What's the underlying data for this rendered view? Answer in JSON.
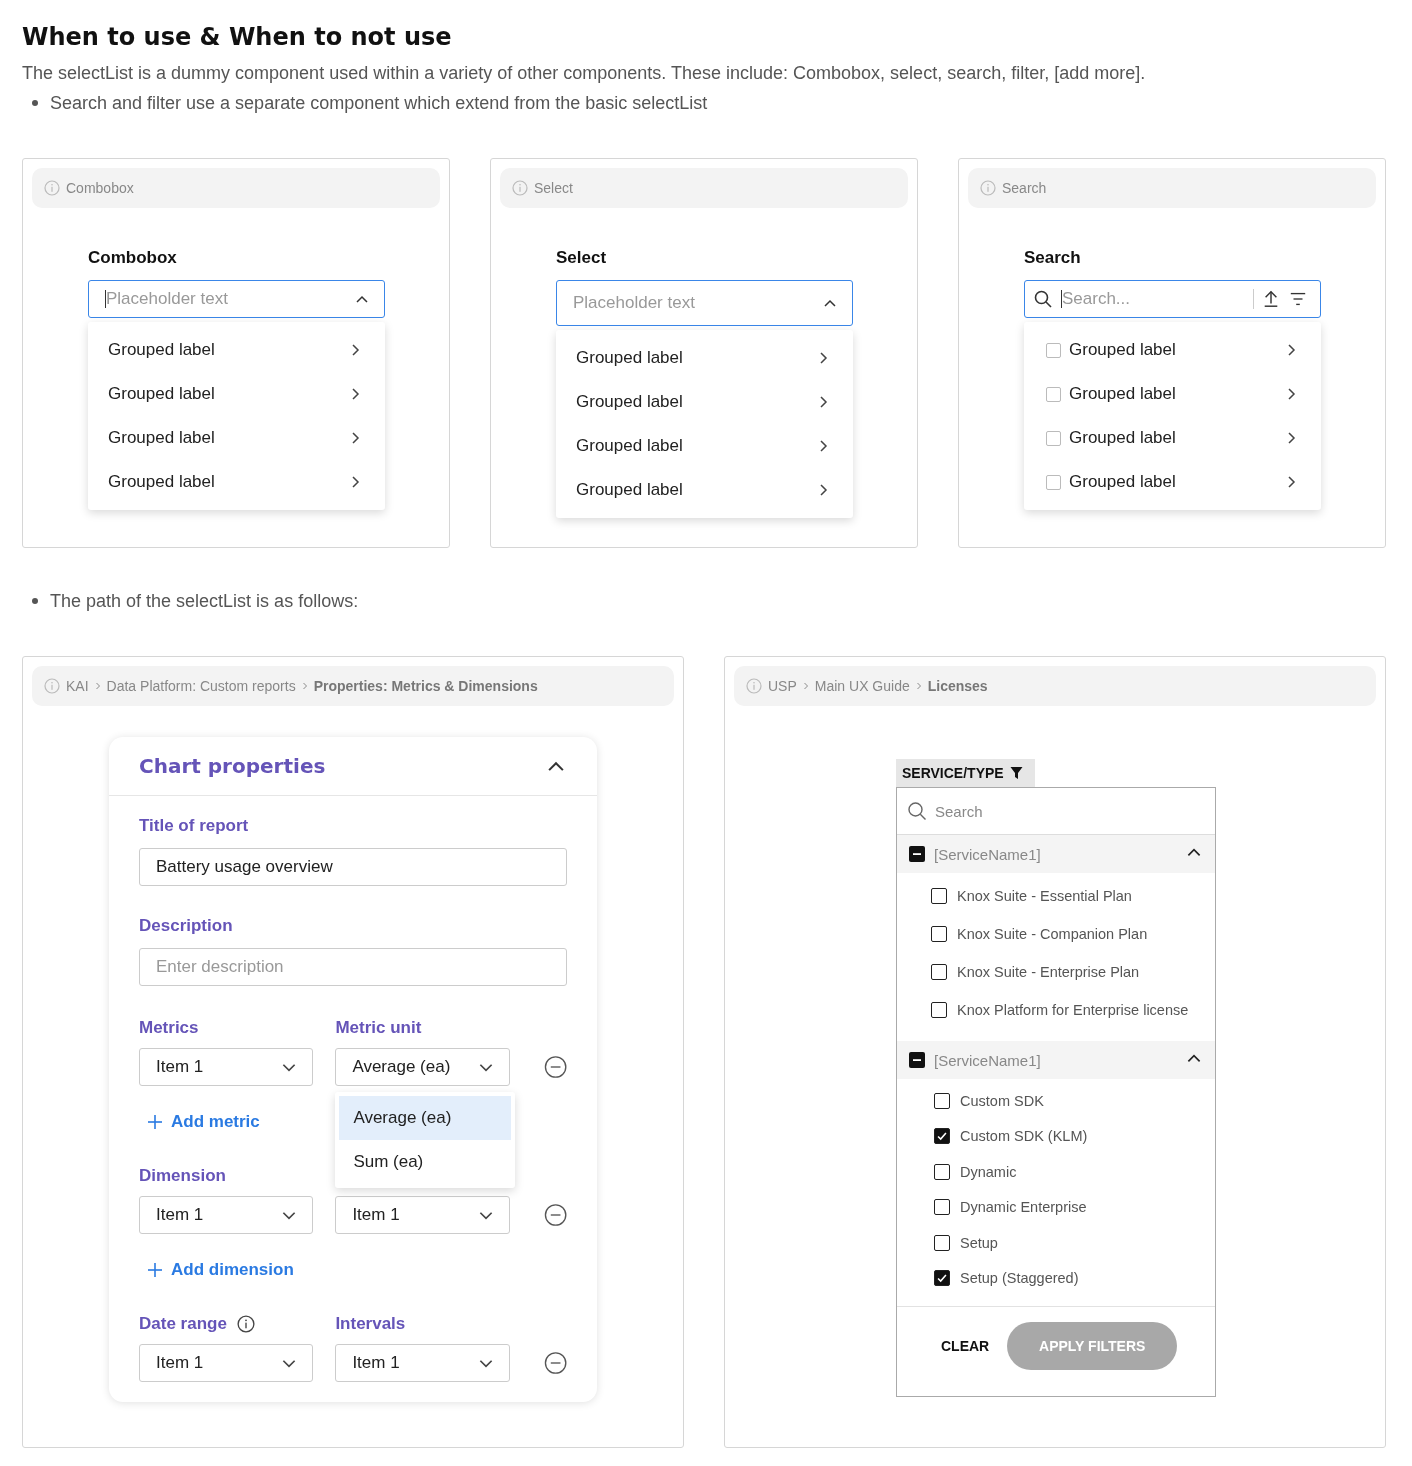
{
  "heading": "When to use & When to not use",
  "intro": "The selectList is a dummy component used within a variety of other components. These include: Combobox, select, search, filter, [add more].",
  "bullets": [
    "Search and filter use a separate component which extend from the basic selectList"
  ],
  "examples": [
    {
      "kind": "combobox",
      "tag": "Combobox",
      "label": "Combobox",
      "placeholder": "Placeholder text",
      "focused": true,
      "expanded": true,
      "options": [
        {
          "label": "Grouped label"
        },
        {
          "label": "Grouped label"
        },
        {
          "label": "Grouped label"
        },
        {
          "label": "Grouped label"
        }
      ]
    },
    {
      "kind": "select",
      "tag": "Select",
      "label": "Select",
      "placeholder": "Placeholder text",
      "focused": false,
      "expanded": true,
      "options": [
        {
          "label": "Grouped label"
        },
        {
          "label": "Grouped label"
        },
        {
          "label": "Grouped label"
        },
        {
          "label": "Grouped label"
        }
      ]
    },
    {
      "kind": "search",
      "tag": "Search",
      "label": "Search",
      "placeholder": "Search...",
      "focused": true,
      "expanded": true,
      "options": [
        {
          "label": "Grouped label",
          "checked": false
        },
        {
          "label": "Grouped label",
          "checked": false
        },
        {
          "label": "Grouped label",
          "checked": false
        },
        {
          "label": "Grouped label",
          "checked": false
        }
      ]
    }
  ],
  "path_note": "The path of the selectList is as follows:",
  "chart_example": {
    "breadcrumb": [
      {
        "label": "KAI",
        "current": false
      },
      {
        "label": "Data Platform: Custom reports",
        "current": false
      },
      {
        "label": "Properties: Metrics & Dimensions",
        "current": true
      }
    ],
    "title": "Chart properties",
    "expanded": true,
    "title_field": {
      "label": "Title of report",
      "value": "Battery usage overview"
    },
    "description_field": {
      "label": "Description",
      "placeholder": "Enter description"
    },
    "rows": [
      {
        "fields": [
          {
            "label": "Metrics",
            "value": "Item 1",
            "info": false
          },
          {
            "label": "Metric unit",
            "value": "Average (ea)",
            "info": false,
            "menu": [
              {
                "label": "Average (ea)",
                "selected": true
              },
              {
                "label": "Sum (ea)",
                "selected": false
              }
            ]
          }
        ],
        "add": "Add metric"
      },
      {
        "fields": [
          {
            "label": "Dimension",
            "value": "Item 1",
            "info": false
          },
          {
            "value": "Item 1"
          }
        ],
        "add": "Add dimension"
      },
      {
        "fields": [
          {
            "label": "Date range",
            "value": "Item 1",
            "info": true
          },
          {
            "label": "Intervals",
            "value": "Item 1",
            "info": false
          }
        ]
      }
    ]
  },
  "filter_example": {
    "breadcrumb": [
      {
        "label": "USP",
        "current": false
      },
      {
        "label": "Main UX Guide",
        "current": false
      },
      {
        "label": "Licenses",
        "current": true
      }
    ],
    "column": "SERVICE/TYPE",
    "search_placeholder": "Search",
    "groups": [
      {
        "name": "[ServiceName1]",
        "indeterminate": true,
        "expanded": true,
        "items": [
          {
            "label": "Knox Suite - Essential Plan",
            "checked": false
          },
          {
            "label": "Knox Suite - Companion Plan",
            "checked": false
          },
          {
            "label": "Knox Suite - Enterprise Plan",
            "checked": false
          },
          {
            "label": "Knox Platform for Enterprise license",
            "checked": false
          }
        ]
      },
      {
        "name": "[ServiceName1]",
        "indeterminate": true,
        "expanded": true,
        "items": [
          {
            "label": "Custom SDK",
            "checked": false
          },
          {
            "label": "Custom SDK (KLM)",
            "checked": true
          },
          {
            "label": "Dynamic",
            "checked": false
          },
          {
            "label": "Dynamic Enterprise",
            "checked": false
          },
          {
            "label": "Setup",
            "checked": false
          },
          {
            "label": "Setup (Staggered)",
            "checked": true
          }
        ]
      }
    ],
    "clear": "CLEAR",
    "apply": {
      "label": "APPLY FILTERS",
      "disabled": true
    }
  }
}
